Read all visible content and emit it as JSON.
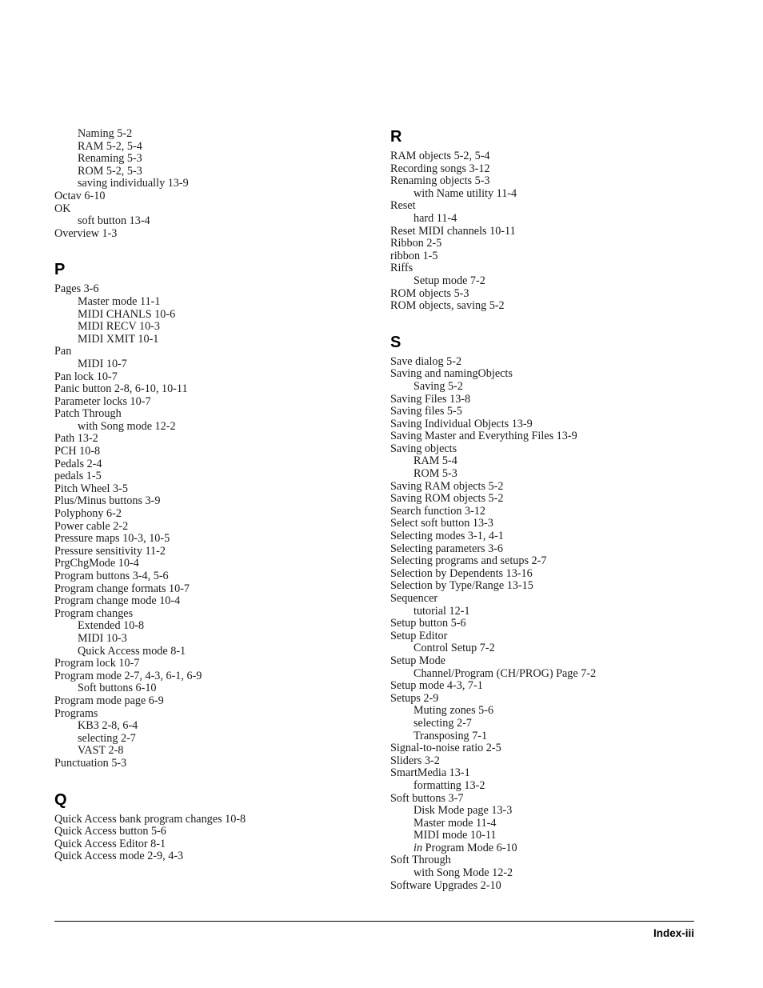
{
  "page": {
    "footer_label": "Index-iii",
    "rule_color": "#000000",
    "text_color": "#000000"
  },
  "columns": {
    "left": [
      {
        "letter": "",
        "entries": [
          {
            "text": "Naming 5-2",
            "level": 1
          },
          {
            "text": "RAM 5-2, 5-4",
            "level": 1
          },
          {
            "text": "Renaming 5-3",
            "level": 1
          },
          {
            "text": "ROM 5-2, 5-3",
            "level": 1
          },
          {
            "text": "saving individually 13-9",
            "level": 1
          },
          {
            "text": "Octav 6-10",
            "level": 0
          },
          {
            "text": "OK",
            "level": 0
          },
          {
            "text": "soft button 13-4",
            "level": 1
          },
          {
            "text": "Overview 1-3",
            "level": 0
          }
        ]
      },
      {
        "letter": "P",
        "entries": [
          {
            "text": "Pages 3-6",
            "level": 0
          },
          {
            "text": "Master mode 11-1",
            "level": 1
          },
          {
            "text": "MIDI CHANLS 10-6",
            "level": 1
          },
          {
            "text": "MIDI RECV 10-3",
            "level": 1
          },
          {
            "text": "MIDI XMIT 10-1",
            "level": 1
          },
          {
            "text": "Pan",
            "level": 0
          },
          {
            "text": "MIDI 10-7",
            "level": 1
          },
          {
            "text": "Pan lock 10-7",
            "level": 0
          },
          {
            "text": "Panic button 2-8, 6-10, 10-11",
            "level": 0
          },
          {
            "text": "Parameter locks 10-7",
            "level": 0
          },
          {
            "text": "Patch Through",
            "level": 0
          },
          {
            "text": "with Song mode 12-2",
            "level": 1
          },
          {
            "text": "Path 13-2",
            "level": 0
          },
          {
            "text": "PCH 10-8",
            "level": 0
          },
          {
            "text": "Pedals 2-4",
            "level": 0
          },
          {
            "text": "pedals 1-5",
            "level": 0
          },
          {
            "text": "Pitch Wheel 3-5",
            "level": 0
          },
          {
            "text": "Plus/Minus buttons 3-9",
            "level": 0
          },
          {
            "text": "Polyphony 6-2",
            "level": 0
          },
          {
            "text": "Power cable 2-2",
            "level": 0
          },
          {
            "text": "Pressure maps 10-3, 10-5",
            "level": 0
          },
          {
            "text": "Pressure sensitivity 11-2",
            "level": 0
          },
          {
            "text": "PrgChgMode 10-4",
            "level": 0
          },
          {
            "text": "Program buttons 3-4, 5-6",
            "level": 0
          },
          {
            "text": "Program change formats 10-7",
            "level": 0
          },
          {
            "text": "Program change mode 10-4",
            "level": 0
          },
          {
            "text": "Program changes",
            "level": 0
          },
          {
            "text": "Extended 10-8",
            "level": 1
          },
          {
            "text": "MIDI 10-3",
            "level": 1
          },
          {
            "text": "Quick Access mode 8-1",
            "level": 1
          },
          {
            "text": "Program lock 10-7",
            "level": 0
          },
          {
            "text": "Program mode 2-7, 4-3, 6-1, 6-9",
            "level": 0
          },
          {
            "text": "Soft buttons 6-10",
            "level": 1
          },
          {
            "text": "Program mode page 6-9",
            "level": 0
          },
          {
            "text": "Programs",
            "level": 0
          },
          {
            "text": "KB3 2-8, 6-4",
            "level": 1
          },
          {
            "text": "selecting 2-7",
            "level": 1
          },
          {
            "text": "VAST 2-8",
            "level": 1
          },
          {
            "text": "Punctuation 5-3",
            "level": 0
          }
        ]
      },
      {
        "letter": "Q",
        "entries": [
          {
            "text": "Quick Access bank program changes 10-8",
            "level": 0
          },
          {
            "text": "Quick Access button 5-6",
            "level": 0
          },
          {
            "text": "Quick Access Editor 8-1",
            "level": 0
          },
          {
            "text": "Quick Access mode 2-9, 4-3",
            "level": 0
          }
        ]
      }
    ],
    "right": [
      {
        "letter": "R",
        "entries": [
          {
            "text": "RAM objects 5-2, 5-4",
            "level": 0
          },
          {
            "text": "Recording songs 3-12",
            "level": 0
          },
          {
            "text": "Renaming objects 5-3",
            "level": 0
          },
          {
            "text": "with Name utility 11-4",
            "level": 1
          },
          {
            "text": "Reset",
            "level": 0
          },
          {
            "text": "hard 11-4",
            "level": 1
          },
          {
            "text": "Reset MIDI channels 10-11",
            "level": 0
          },
          {
            "text": "Ribbon 2-5",
            "level": 0
          },
          {
            "text": "ribbon 1-5",
            "level": 0
          },
          {
            "text": "Riffs",
            "level": 0
          },
          {
            "text": "Setup mode 7-2",
            "level": 1
          },
          {
            "text": "ROM objects 5-3",
            "level": 0
          },
          {
            "text": "ROM objects, saving 5-2",
            "level": 0
          }
        ]
      },
      {
        "letter": "S",
        "entries": [
          {
            "text": "Save dialog 5-2",
            "level": 0
          },
          {
            "text": "Saving and namingObjects",
            "level": 0
          },
          {
            "text": "Saving 5-2",
            "level": 1
          },
          {
            "text": "Saving Files 13-8",
            "level": 0
          },
          {
            "text": "Saving files 5-5",
            "level": 0
          },
          {
            "text": "Saving Individual Objects 13-9",
            "level": 0
          },
          {
            "text": "Saving Master and Everything Files 13-9",
            "level": 0
          },
          {
            "text": "Saving objects",
            "level": 0
          },
          {
            "text": "RAM 5-4",
            "level": 1
          },
          {
            "text": "ROM 5-3",
            "level": 1
          },
          {
            "text": "Saving RAM objects 5-2",
            "level": 0
          },
          {
            "text": "Saving ROM objects 5-2",
            "level": 0
          },
          {
            "text": "Search function 3-12",
            "level": 0
          },
          {
            "text": "Select soft button 13-3",
            "level": 0
          },
          {
            "text": "Selecting modes 3-1, 4-1",
            "level": 0
          },
          {
            "text": "Selecting parameters 3-6",
            "level": 0
          },
          {
            "text": "Selecting programs and setups 2-7",
            "level": 0
          },
          {
            "text": "Selection by Dependents 13-16",
            "level": 0
          },
          {
            "text": "Selection by Type/Range 13-15",
            "level": 0
          },
          {
            "text": "Sequencer",
            "level": 0
          },
          {
            "text": "tutorial 12-1",
            "level": 1
          },
          {
            "text": "Setup button 5-6",
            "level": 0
          },
          {
            "text": "Setup Editor",
            "level": 0
          },
          {
            "text": "Control Setup 7-2",
            "level": 1
          },
          {
            "text": "Setup Mode",
            "level": 0
          },
          {
            "text": "Channel/Program (CH/PROG) Page 7-2",
            "level": 1
          },
          {
            "text": "Setup mode 4-3, 7-1",
            "level": 0
          },
          {
            "text": "Setups 2-9",
            "level": 0
          },
          {
            "text": "Muting zones 5-6",
            "level": 1
          },
          {
            "text": "selecting 2-7",
            "level": 1
          },
          {
            "text": "Transposing 7-1",
            "level": 1
          },
          {
            "text": "Signal-to-noise ratio 2-5",
            "level": 0
          },
          {
            "text": "Sliders 3-2",
            "level": 0
          },
          {
            "text": "SmartMedia 13-1",
            "level": 0
          },
          {
            "text": "formatting 13-2",
            "level": 1
          },
          {
            "text": "Soft buttons 3-7",
            "level": 0
          },
          {
            "text": "Disk Mode page 13-3",
            "level": 1
          },
          {
            "text": "Master mode 11-4",
            "level": 1
          },
          {
            "text": "MIDI mode 10-11",
            "level": 1
          },
          {
            "text": "in Program Mode 6-10",
            "level": 1,
            "italic_prefix": "in"
          },
          {
            "text": "Soft Through",
            "level": 0
          },
          {
            "text": "with Song Mode 12-2",
            "level": 1
          },
          {
            "text": "Software Upgrades 2-10",
            "level": 0
          }
        ]
      }
    ]
  }
}
